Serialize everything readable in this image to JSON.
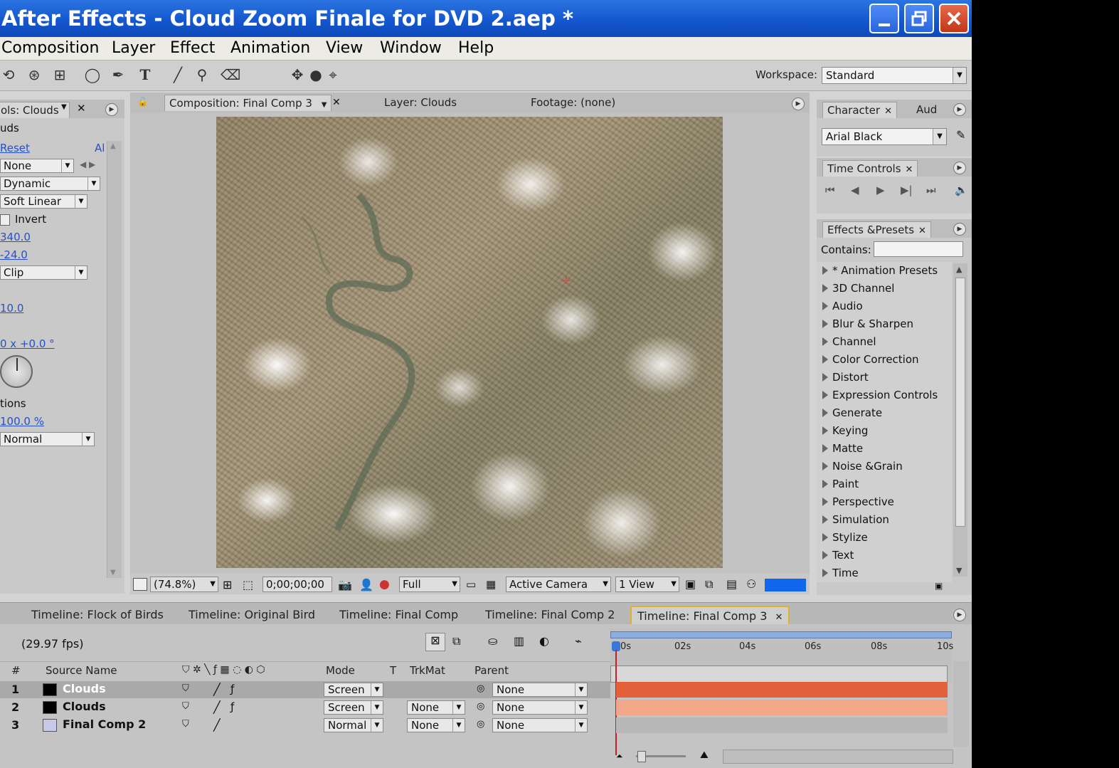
{
  "window": {
    "title": "After Effects - Cloud Zoom Finale for DVD 2.aep *"
  },
  "menu": [
    "Composition",
    "Layer",
    "Effect",
    "Animation",
    "View",
    "Window",
    "Help"
  ],
  "toolbar": {
    "workspace_label": "Workspace:",
    "workspace_value": "Standard"
  },
  "effect_controls": {
    "tab": "ols: Clouds",
    "layer_name": "uds",
    "reset": "Reset",
    "about": "Al",
    "none": "None",
    "dynamic": "Dynamic",
    "soft_linear": "Soft Linear",
    "invert": "Invert",
    "v1": "340.0",
    "v2": "-24.0",
    "clip": "Clip",
    "v3": "10.0",
    "angle": "0 x +0.0 °",
    "options": "tions",
    "percent": "100.0 %",
    "normal": "Normal"
  },
  "comp": {
    "tab_comp": "Composition: Final Comp 3",
    "tab_layer": "Layer: Clouds",
    "tab_footage": "Footage: (none)",
    "zoom": "(74.8%)",
    "timecode": "0;00;00;00",
    "resolution": "Full",
    "camera": "Active Camera",
    "views": "1 View"
  },
  "character": {
    "tab": "Character",
    "tab2": "Aud",
    "font": "Arial Black"
  },
  "time_controls": {
    "tab": "Time Controls"
  },
  "effects_presets": {
    "tab": "Effects &Presets",
    "contains_label": "Contains:",
    "items": [
      "* Animation Presets",
      "3D Channel",
      "Audio",
      "Blur & Sharpen",
      "Channel",
      "Color Correction",
      "Distort",
      "Expression Controls",
      "Generate",
      "Keying",
      "Matte",
      "Noise &Grain",
      "Paint",
      "Perspective",
      "Simulation",
      "Stylize",
      "Text",
      "Time"
    ]
  },
  "timeline": {
    "tabs": [
      "Timeline: Flock of Birds",
      "Timeline: Original Bird",
      "Timeline: Final Comp",
      "Timeline: Final Comp 2",
      "Timeline: Final Comp 3"
    ],
    "fps": "(29.97 fps)",
    "headers": {
      "num": "#",
      "source": "Source Name",
      "mode": "Mode",
      "t": "T",
      "trkmat": "TrkMat",
      "parent": "Parent"
    },
    "ruler": [
      "0s",
      "02s",
      "04s",
      "06s",
      "08s",
      "10s"
    ],
    "layers": [
      {
        "num": "1",
        "name": "Clouds",
        "mode": "Screen",
        "trkmat": "",
        "parent": "None",
        "bar_color": "#e4603a"
      },
      {
        "num": "2",
        "name": "Clouds",
        "mode": "Screen",
        "trkmat": "None",
        "parent": "None",
        "bar_color": "#f2a68a"
      },
      {
        "num": "3",
        "name": "Final Comp 2",
        "mode": "Normal",
        "trkmat": "None",
        "parent": "None",
        "bar_color": "#b8b8b8"
      }
    ]
  },
  "colors": {
    "title_bar": "#1457cf",
    "accent_tab": "#e0b030",
    "swatch": "#1166ee"
  }
}
